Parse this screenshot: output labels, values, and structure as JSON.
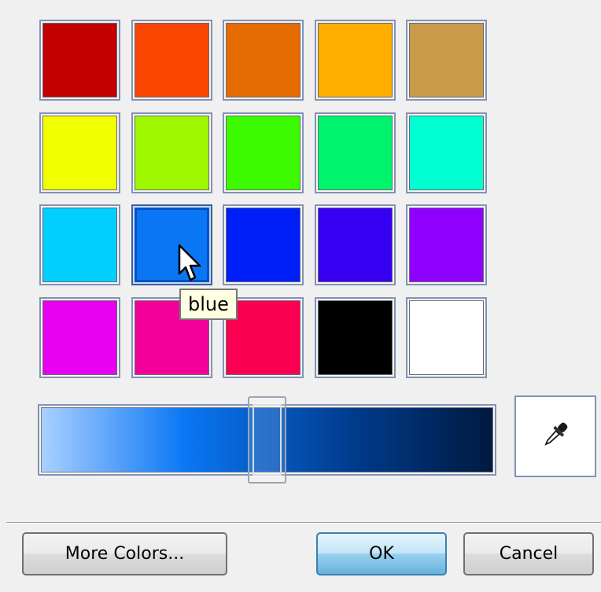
{
  "swatches": [
    {
      "name": "red-1",
      "color": "#c20000"
    },
    {
      "name": "red-orange",
      "color": "#f94600"
    },
    {
      "name": "orange",
      "color": "#e56b00"
    },
    {
      "name": "amber",
      "color": "#ffae00"
    },
    {
      "name": "tan",
      "color": "#c99a4a"
    },
    {
      "name": "yellow",
      "color": "#f2ff00"
    },
    {
      "name": "yellow-green",
      "color": "#9ff800"
    },
    {
      "name": "green",
      "color": "#3cfb00"
    },
    {
      "name": "spring-green",
      "color": "#00f46c"
    },
    {
      "name": "aqua",
      "color": "#00ffd2"
    },
    {
      "name": "sky",
      "color": "#00cfff"
    },
    {
      "name": "blue",
      "color": "#0a76f4",
      "selected": true
    },
    {
      "name": "royal-blue",
      "color": "#001ef7"
    },
    {
      "name": "indigo",
      "color": "#3800f2"
    },
    {
      "name": "violet",
      "color": "#9000ff"
    },
    {
      "name": "magenta",
      "color": "#e800f0"
    },
    {
      "name": "pink",
      "color": "#f20099"
    },
    {
      "name": "rose",
      "color": "#fa0053"
    },
    {
      "name": "black",
      "color": "#000000"
    },
    {
      "name": "white",
      "color": "#ffffff"
    }
  ],
  "slider": {
    "value": 0.5,
    "gradient_colors": [
      "#a9d0ff",
      "#0a76f4",
      "#003a8a",
      "#001a40"
    ]
  },
  "tooltip": {
    "text": "blue"
  },
  "buttons": {
    "more_colors": "More Colors...",
    "ok": "OK",
    "cancel": "Cancel"
  },
  "icons": {
    "eyedropper": "eyedropper-icon",
    "cursor": "cursor-arrow-icon"
  }
}
